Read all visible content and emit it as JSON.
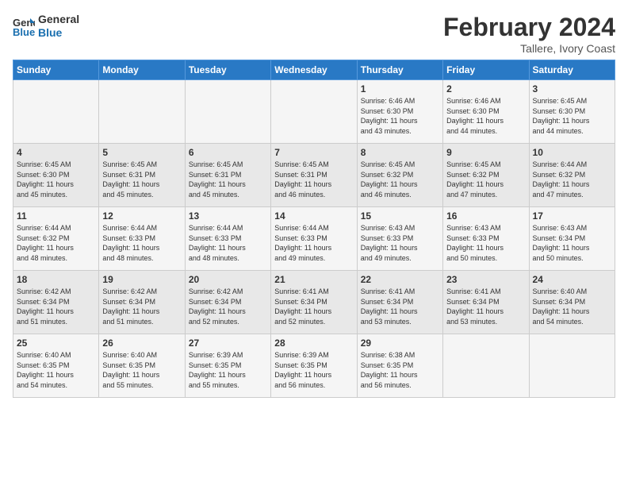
{
  "header": {
    "logo_line1": "General",
    "logo_line2": "Blue",
    "month": "February 2024",
    "location": "Tallere, Ivory Coast"
  },
  "weekdays": [
    "Sunday",
    "Monday",
    "Tuesday",
    "Wednesday",
    "Thursday",
    "Friday",
    "Saturday"
  ],
  "weeks": [
    [
      {
        "day": "",
        "content": ""
      },
      {
        "day": "",
        "content": ""
      },
      {
        "day": "",
        "content": ""
      },
      {
        "day": "",
        "content": ""
      },
      {
        "day": "1",
        "content": "Sunrise: 6:46 AM\nSunset: 6:30 PM\nDaylight: 11 hours\nand 43 minutes."
      },
      {
        "day": "2",
        "content": "Sunrise: 6:46 AM\nSunset: 6:30 PM\nDaylight: 11 hours\nand 44 minutes."
      },
      {
        "day": "3",
        "content": "Sunrise: 6:45 AM\nSunset: 6:30 PM\nDaylight: 11 hours\nand 44 minutes."
      }
    ],
    [
      {
        "day": "4",
        "content": "Sunrise: 6:45 AM\nSunset: 6:30 PM\nDaylight: 11 hours\nand 45 minutes."
      },
      {
        "day": "5",
        "content": "Sunrise: 6:45 AM\nSunset: 6:31 PM\nDaylight: 11 hours\nand 45 minutes."
      },
      {
        "day": "6",
        "content": "Sunrise: 6:45 AM\nSunset: 6:31 PM\nDaylight: 11 hours\nand 45 minutes."
      },
      {
        "day": "7",
        "content": "Sunrise: 6:45 AM\nSunset: 6:31 PM\nDaylight: 11 hours\nand 46 minutes."
      },
      {
        "day": "8",
        "content": "Sunrise: 6:45 AM\nSunset: 6:32 PM\nDaylight: 11 hours\nand 46 minutes."
      },
      {
        "day": "9",
        "content": "Sunrise: 6:45 AM\nSunset: 6:32 PM\nDaylight: 11 hours\nand 47 minutes."
      },
      {
        "day": "10",
        "content": "Sunrise: 6:44 AM\nSunset: 6:32 PM\nDaylight: 11 hours\nand 47 minutes."
      }
    ],
    [
      {
        "day": "11",
        "content": "Sunrise: 6:44 AM\nSunset: 6:32 PM\nDaylight: 11 hours\nand 48 minutes."
      },
      {
        "day": "12",
        "content": "Sunrise: 6:44 AM\nSunset: 6:33 PM\nDaylight: 11 hours\nand 48 minutes."
      },
      {
        "day": "13",
        "content": "Sunrise: 6:44 AM\nSunset: 6:33 PM\nDaylight: 11 hours\nand 48 minutes."
      },
      {
        "day": "14",
        "content": "Sunrise: 6:44 AM\nSunset: 6:33 PM\nDaylight: 11 hours\nand 49 minutes."
      },
      {
        "day": "15",
        "content": "Sunrise: 6:43 AM\nSunset: 6:33 PM\nDaylight: 11 hours\nand 49 minutes."
      },
      {
        "day": "16",
        "content": "Sunrise: 6:43 AM\nSunset: 6:33 PM\nDaylight: 11 hours\nand 50 minutes."
      },
      {
        "day": "17",
        "content": "Sunrise: 6:43 AM\nSunset: 6:34 PM\nDaylight: 11 hours\nand 50 minutes."
      }
    ],
    [
      {
        "day": "18",
        "content": "Sunrise: 6:42 AM\nSunset: 6:34 PM\nDaylight: 11 hours\nand 51 minutes."
      },
      {
        "day": "19",
        "content": "Sunrise: 6:42 AM\nSunset: 6:34 PM\nDaylight: 11 hours\nand 51 minutes."
      },
      {
        "day": "20",
        "content": "Sunrise: 6:42 AM\nSunset: 6:34 PM\nDaylight: 11 hours\nand 52 minutes."
      },
      {
        "day": "21",
        "content": "Sunrise: 6:41 AM\nSunset: 6:34 PM\nDaylight: 11 hours\nand 52 minutes."
      },
      {
        "day": "22",
        "content": "Sunrise: 6:41 AM\nSunset: 6:34 PM\nDaylight: 11 hours\nand 53 minutes."
      },
      {
        "day": "23",
        "content": "Sunrise: 6:41 AM\nSunset: 6:34 PM\nDaylight: 11 hours\nand 53 minutes."
      },
      {
        "day": "24",
        "content": "Sunrise: 6:40 AM\nSunset: 6:34 PM\nDaylight: 11 hours\nand 54 minutes."
      }
    ],
    [
      {
        "day": "25",
        "content": "Sunrise: 6:40 AM\nSunset: 6:35 PM\nDaylight: 11 hours\nand 54 minutes."
      },
      {
        "day": "26",
        "content": "Sunrise: 6:40 AM\nSunset: 6:35 PM\nDaylight: 11 hours\nand 55 minutes."
      },
      {
        "day": "27",
        "content": "Sunrise: 6:39 AM\nSunset: 6:35 PM\nDaylight: 11 hours\nand 55 minutes."
      },
      {
        "day": "28",
        "content": "Sunrise: 6:39 AM\nSunset: 6:35 PM\nDaylight: 11 hours\nand 56 minutes."
      },
      {
        "day": "29",
        "content": "Sunrise: 6:38 AM\nSunset: 6:35 PM\nDaylight: 11 hours\nand 56 minutes."
      },
      {
        "day": "",
        "content": ""
      },
      {
        "day": "",
        "content": ""
      }
    ]
  ]
}
